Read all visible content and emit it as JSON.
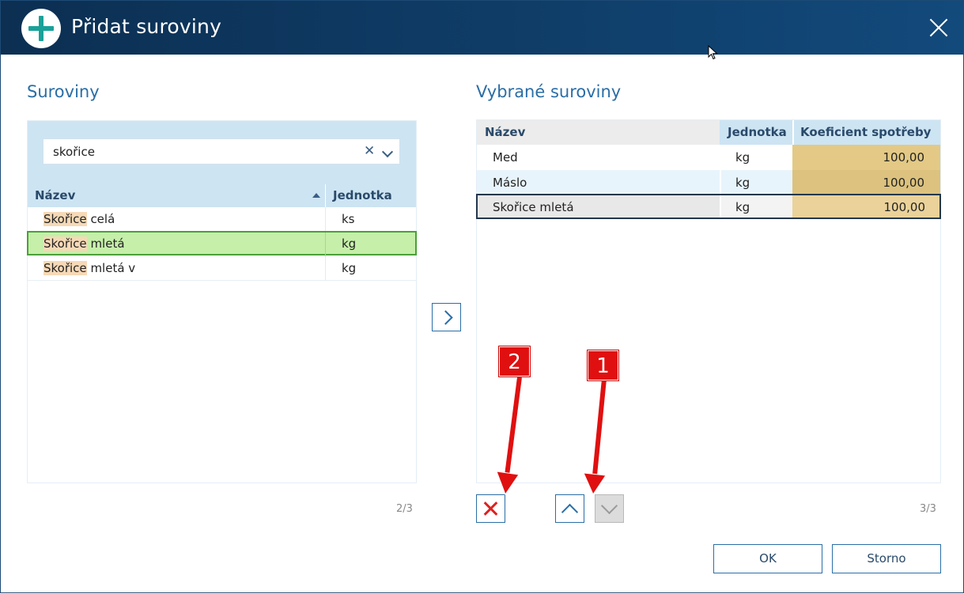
{
  "window": {
    "title": "Přidat suroviny"
  },
  "left": {
    "section_title": "Suroviny",
    "search": {
      "value": "skořice"
    },
    "columns": {
      "name": "Název",
      "unit": "Jednotka"
    },
    "rows": [
      {
        "highlight": "Skořice",
        "rest": " celá",
        "unit": "ks"
      },
      {
        "highlight": "Skořice",
        "rest": " mletá",
        "unit": "kg"
      },
      {
        "highlight": "Skořice",
        "rest": " mletá v",
        "unit": "kg"
      }
    ],
    "counter": "2/3"
  },
  "right": {
    "section_title": "Vybrané suroviny",
    "columns": {
      "name": "Název",
      "unit": "Jednotka",
      "coef": "Koeficient spotřeby"
    },
    "rows": [
      {
        "name": "Med",
        "unit": "kg",
        "coef": "100,00"
      },
      {
        "name": "Máslo",
        "unit": "kg",
        "coef": "100,00"
      },
      {
        "name": "Skořice mletá",
        "unit": "kg",
        "coef": "100,00"
      }
    ],
    "counter": "3/3"
  },
  "annotations": {
    "badge_1": "1",
    "badge_2": "2"
  },
  "buttons": {
    "ok": "OK",
    "cancel": "Storno"
  },
  "colors": {
    "titlebar": "#0f3d68",
    "accent": "#2a6ea6",
    "selection_green": "#c6efa9",
    "coef_cell": "#e3c985",
    "annotation_red": "#e01010"
  }
}
